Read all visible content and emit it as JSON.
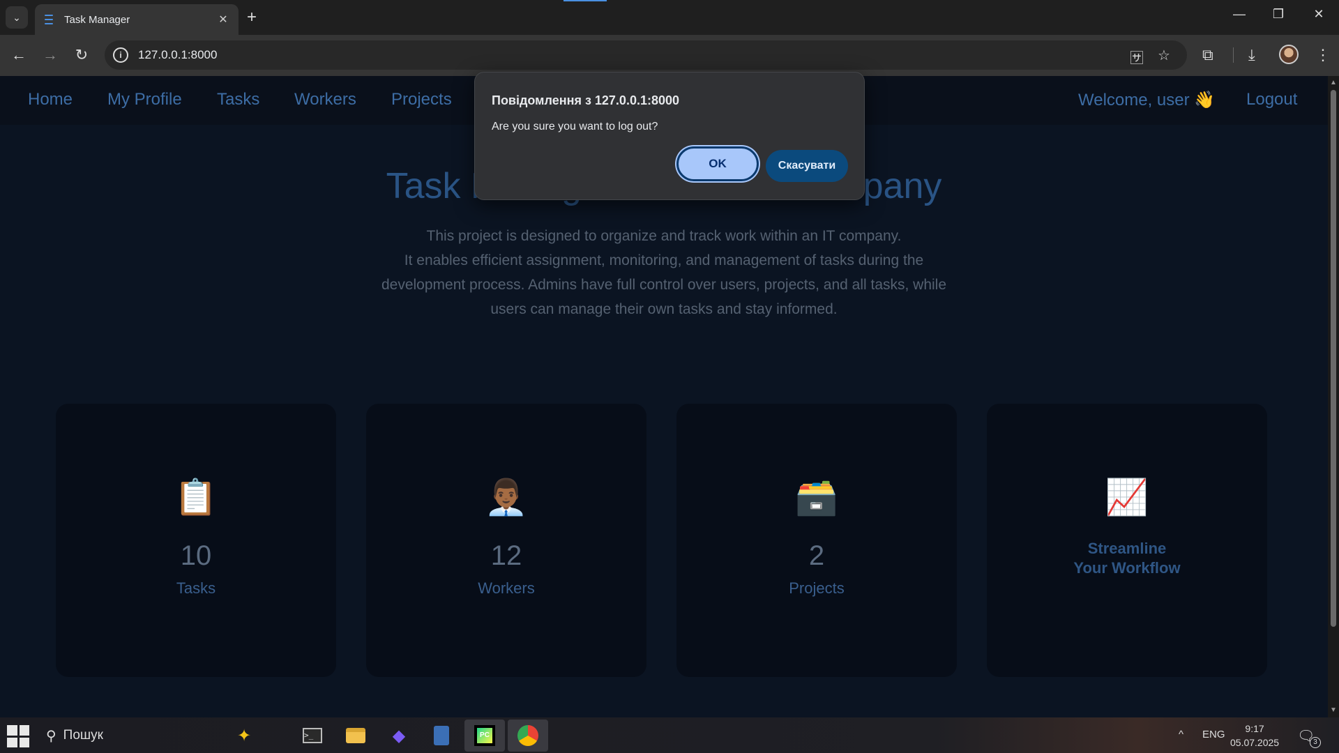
{
  "browser": {
    "tab_title": "Task Manager",
    "url": "127.0.0.1:8000",
    "icons": {
      "tab_search": "chevron-down-icon",
      "close_tab": "close-icon",
      "new_tab": "plus-icon",
      "back": "arrow-left-icon",
      "forward": "arrow-right-icon",
      "reload": "reload-icon",
      "site_info": "info-icon",
      "translate": "translate-icon",
      "bookmark": "star-icon",
      "extensions": "puzzle-icon",
      "downloads": "download-icon",
      "menu": "kebab-menu-icon"
    }
  },
  "site": {
    "nav": {
      "home": "Home",
      "profile": "My Profile",
      "tasks": "Tasks",
      "workers": "Workers",
      "projects": "Projects",
      "welcome": "Welcome, user",
      "welcome_emoji": "👋",
      "logout": "Logout"
    },
    "hero": {
      "title": "Task Management for IT Company",
      "description_lines": [
        "This project is designed to organize and track work within an IT company.",
        "It enables efficient assignment, monitoring, and management of tasks during the",
        "development process. Admins have full control over users, projects, and all tasks, while",
        "users can manage their own tasks and stay informed."
      ]
    },
    "cards": [
      {
        "emoji": "📋",
        "number": "10",
        "label": "Tasks"
      },
      {
        "emoji": "👨🏾‍💼",
        "number": "12",
        "label": "Workers"
      },
      {
        "emoji": "🗃️",
        "number": "2",
        "label": "Projects"
      },
      {
        "emoji": "📈",
        "feature_lines": [
          "Streamline",
          "Your Workflow"
        ]
      }
    ],
    "colors": {
      "background": "#0b1422",
      "nav_link": "#3d6da5",
      "card_background": "#070d18"
    }
  },
  "dialog": {
    "title": "Повідомлення з 127.0.0.1:8000",
    "message": "Are you sure you want to log out?",
    "ok_label": "OK",
    "cancel_label": "Скасувати",
    "ok_color": "#a8c7fa",
    "cancel_color": "#0b4a7d"
  },
  "taskbar": {
    "search_label": "Пошук",
    "language": "ENG",
    "time": "9:17",
    "date": "05.07.2025",
    "notification_count": "3",
    "apps": [
      "copilot-icon",
      "terminal-icon",
      "file-explorer-icon",
      "obsidian-icon",
      "calculator-icon",
      "pycharm-icon",
      "chrome-icon"
    ]
  }
}
